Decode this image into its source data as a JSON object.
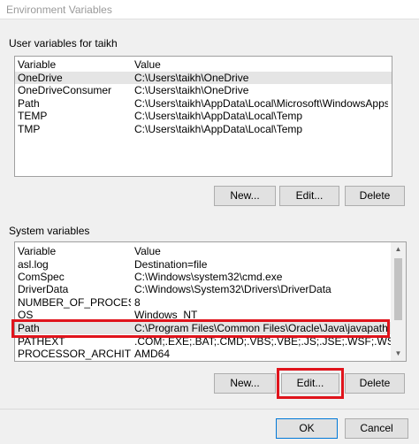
{
  "window": {
    "title": "Environment Variables"
  },
  "user_section": {
    "label": "User variables for taikh",
    "columns": {
      "variable": "Variable",
      "value": "Value"
    },
    "rows": [
      {
        "variable": "OneDrive",
        "value": "C:\\Users\\taikh\\OneDrive"
      },
      {
        "variable": "OneDriveConsumer",
        "value": "C:\\Users\\taikh\\OneDrive"
      },
      {
        "variable": "Path",
        "value": "C:\\Users\\taikh\\AppData\\Local\\Microsoft\\WindowsApps;C:\\Users\\ta..."
      },
      {
        "variable": "TEMP",
        "value": "C:\\Users\\taikh\\AppData\\Local\\Temp"
      },
      {
        "variable": "TMP",
        "value": "C:\\Users\\taikh\\AppData\\Local\\Temp"
      }
    ],
    "buttons": {
      "new": "New...",
      "edit": "Edit...",
      "delete": "Delete"
    }
  },
  "system_section": {
    "label": "System variables",
    "columns": {
      "variable": "Variable",
      "value": "Value"
    },
    "rows": [
      {
        "variable": "asl.log",
        "value": "Destination=file"
      },
      {
        "variable": "ComSpec",
        "value": "C:\\Windows\\system32\\cmd.exe"
      },
      {
        "variable": "DriverData",
        "value": "C:\\Windows\\System32\\Drivers\\DriverData"
      },
      {
        "variable": "NUMBER_OF_PROCESSORS",
        "value": "8"
      },
      {
        "variable": "OS",
        "value": "Windows_NT"
      },
      {
        "variable": "Path",
        "value": "C:\\Program Files\\Common Files\\Oracle\\Java\\javapath;C:\\Program F..."
      },
      {
        "variable": "PATHEXT",
        "value": ".COM;.EXE;.BAT;.CMD;.VBS;.VBE;.JS;.JSE;.WSF;.WSH;.MSC"
      },
      {
        "variable": "PROCESSOR_ARCHITECTURE",
        "value": "AMD64"
      }
    ],
    "buttons": {
      "new": "New...",
      "edit": "Edit...",
      "delete": "Delete"
    }
  },
  "footer": {
    "ok": "OK",
    "cancel": "Cancel"
  },
  "colors": {
    "highlight": "#e0141c",
    "accent": "#0078d7"
  }
}
